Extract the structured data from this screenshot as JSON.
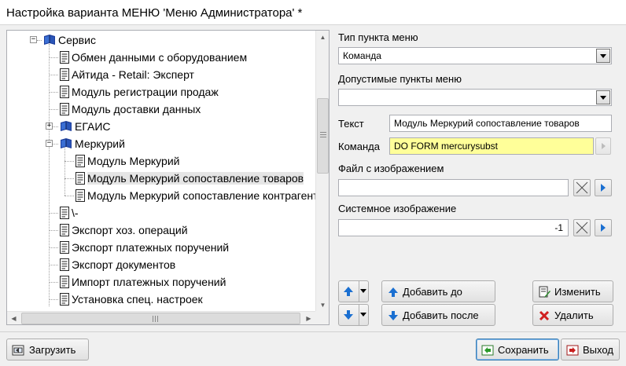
{
  "window": {
    "title": "Настройка варианта МЕНЮ 'Меню Администратора' *"
  },
  "tree": {
    "items": [
      {
        "label": "Сервис",
        "kind": "folder",
        "expander": "−",
        "level": 1
      },
      {
        "label": "Обмен данными с оборудованием",
        "kind": "item",
        "level": 2
      },
      {
        "label": "Айтида - Retail: Эксперт",
        "kind": "item",
        "level": 2
      },
      {
        "label": "Модуль регистрации продаж",
        "kind": "item",
        "level": 2
      },
      {
        "label": "Модуль доставки данных",
        "kind": "item",
        "level": 2
      },
      {
        "label": "ЕГАИС",
        "kind": "folder",
        "expander": "+",
        "level": 2
      },
      {
        "label": "Меркурий",
        "kind": "folder",
        "expander": "−",
        "level": 2
      },
      {
        "label": "Модуль Меркурий",
        "kind": "item",
        "level": 3
      },
      {
        "label": "Модуль Меркурий сопоставление товаров",
        "kind": "item",
        "level": 3,
        "selected": true
      },
      {
        "label": "Модуль Меркурий сопоставление контрагентов",
        "kind": "item",
        "level": 3
      },
      {
        "label": "\\-",
        "kind": "item",
        "level": 2
      },
      {
        "label": "Экспорт хоз. операций",
        "kind": "item",
        "level": 2
      },
      {
        "label": "Экспорт платежных поручений",
        "kind": "item",
        "level": 2
      },
      {
        "label": "Экспорт документов",
        "kind": "item",
        "level": 2
      },
      {
        "label": "Импорт платежных поручений",
        "kind": "item",
        "level": 2
      },
      {
        "label": "Установка спец. настроек",
        "kind": "item",
        "level": 2
      }
    ]
  },
  "form": {
    "menu_type_label": "Тип пункта меню",
    "menu_type_value": "Команда",
    "allowed_items_label": "Допустимые пункты меню",
    "allowed_items_value": "",
    "text_label": "Текст",
    "text_value": "Модуль Меркурий сопоставление товаров",
    "command_label": "Команда",
    "command_value": "DO FORM mercurysubst",
    "image_file_label": "Файл с изображением",
    "image_file_value": "",
    "system_image_label": "Системное изображение",
    "system_image_value": "-1"
  },
  "buttons": {
    "add_before": "Добавить до",
    "add_after": "Добавить после",
    "edit": "Изменить",
    "delete": "Удалить",
    "load": "Загрузить",
    "save": "Сохранить",
    "exit": "Выход"
  },
  "colors": {
    "command_highlight": "#ffff99",
    "arrow_blue": "#1a6fd1",
    "book_blue": "#1e3f9c",
    "delete_red": "#d02020"
  },
  "icons": {
    "folder": "book-icon",
    "item": "document-icon"
  }
}
